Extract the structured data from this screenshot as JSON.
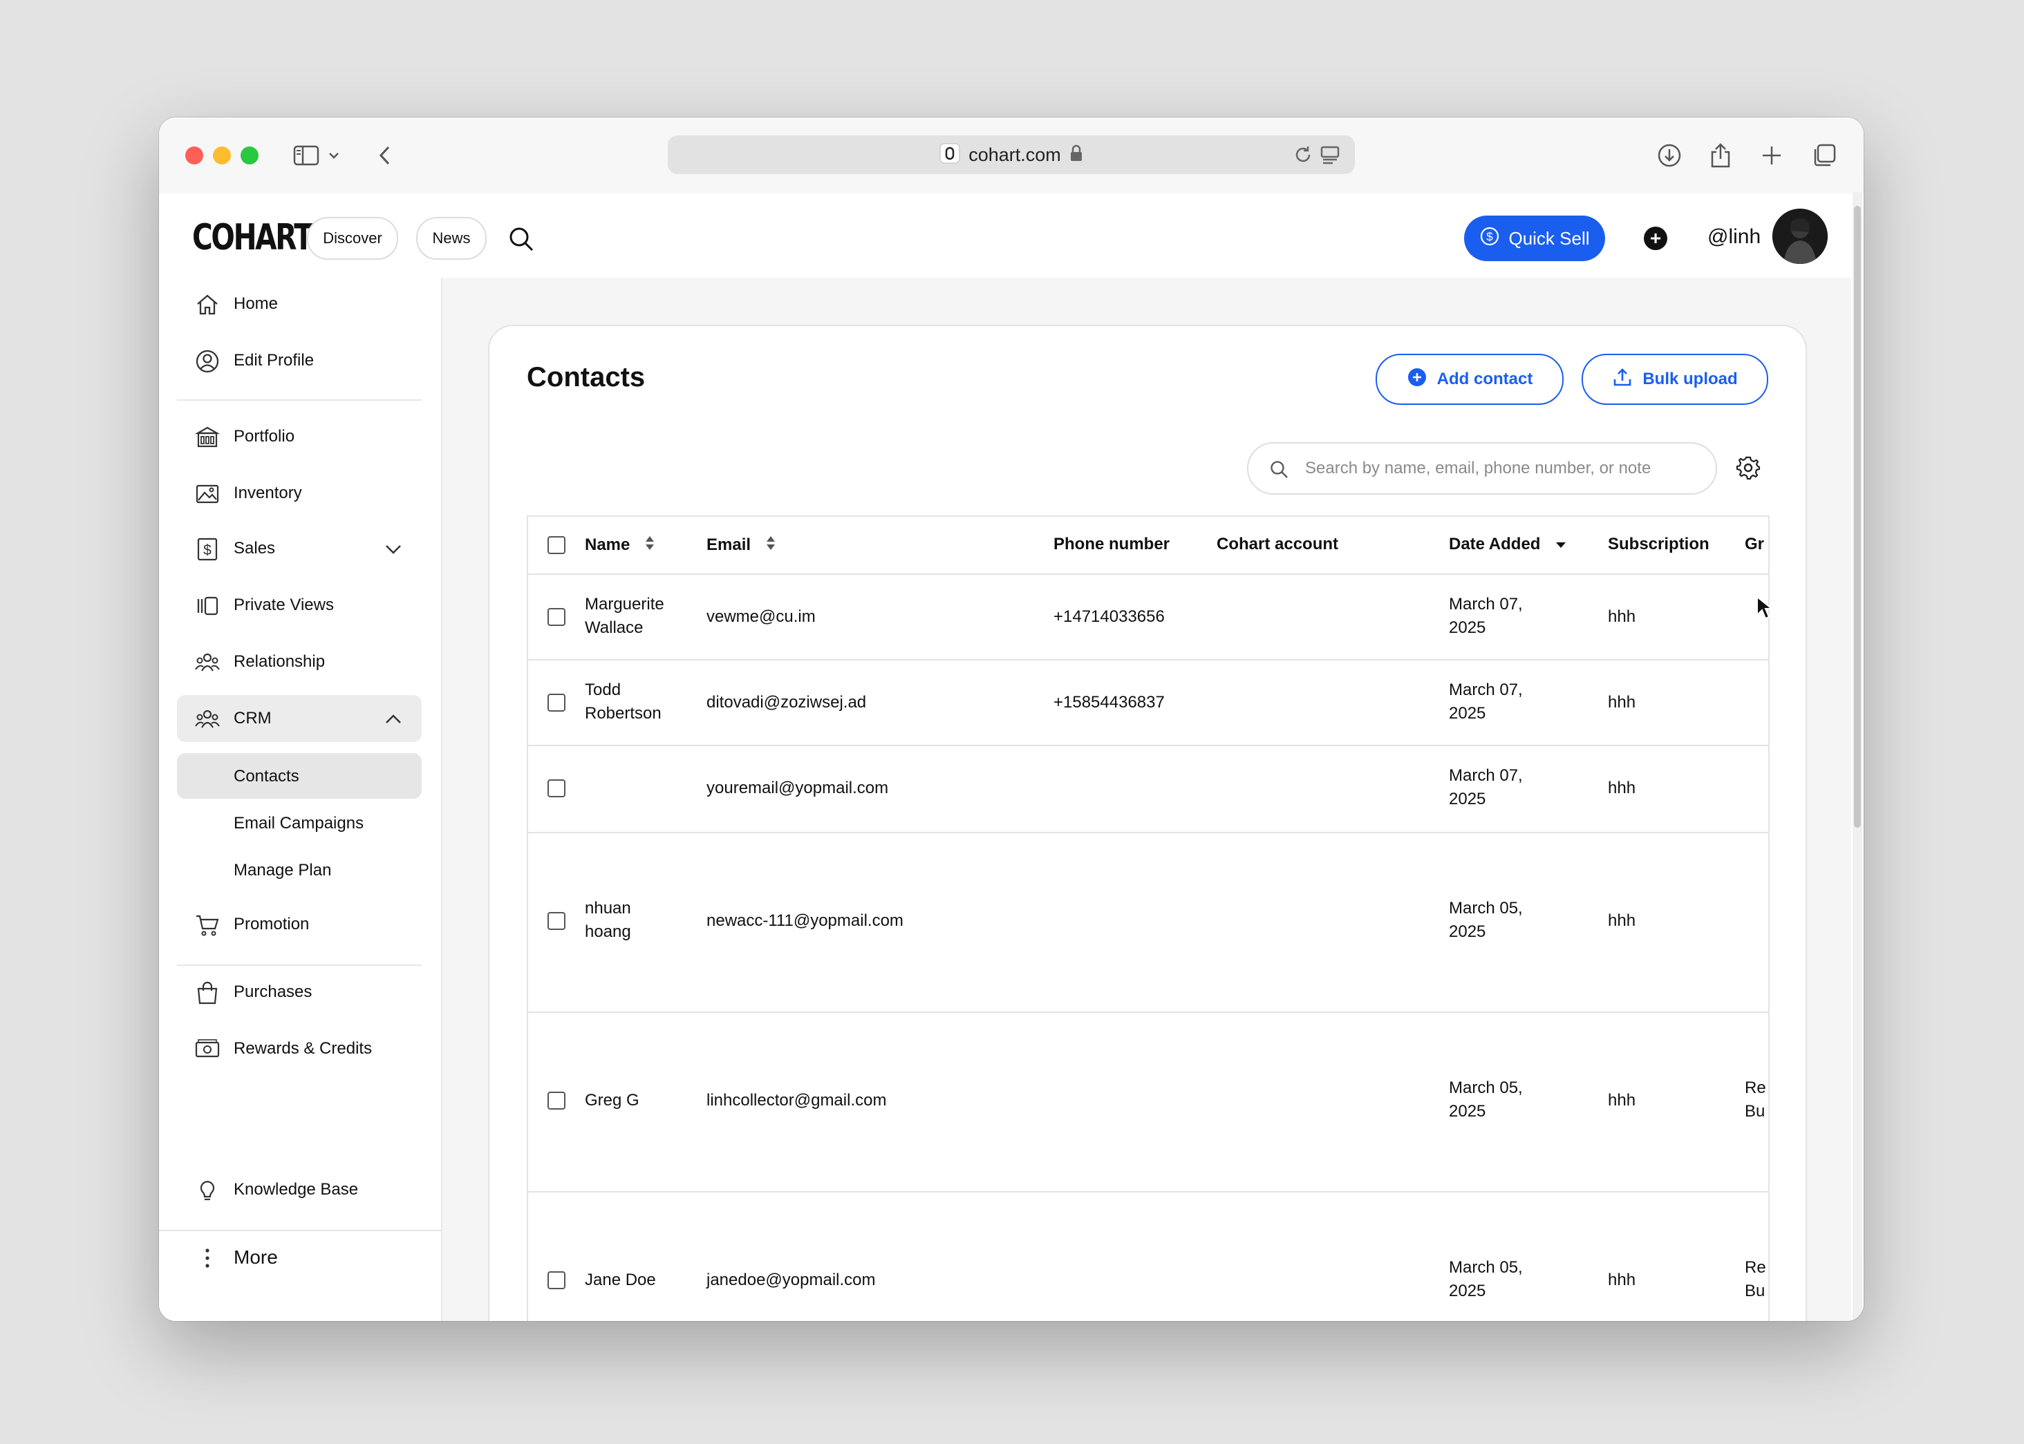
{
  "browser": {
    "url": "cohart.com"
  },
  "header": {
    "logo": "COHART",
    "nav": [
      "Discover",
      "News"
    ],
    "quick_sell_label": "Quick Sell",
    "username": "@linh"
  },
  "sidebar": {
    "items": [
      {
        "label": "Home",
        "icon": "home-icon"
      },
      {
        "label": "Edit Profile",
        "icon": "user-circle-icon"
      },
      {
        "label": "Portfolio",
        "icon": "building-icon"
      },
      {
        "label": "Inventory",
        "icon": "image-icon"
      },
      {
        "label": "Sales",
        "icon": "dollar-icon"
      },
      {
        "label": "Private Views",
        "icon": "views-icon"
      },
      {
        "label": "Relationship",
        "icon": "people-icon"
      },
      {
        "label": "CRM",
        "icon": "people-icon"
      },
      {
        "label": "Promotion",
        "icon": "cart-icon"
      },
      {
        "label": "Purchases",
        "icon": "bag-icon"
      },
      {
        "label": "Rewards & Credits",
        "icon": "money-icon"
      },
      {
        "label": "Knowledge Base",
        "icon": "bulb-icon"
      },
      {
        "label": "More",
        "icon": "more-icon"
      }
    ],
    "crm_sub": [
      "Contacts",
      "Email Campaigns",
      "Manage Plan"
    ]
  },
  "main": {
    "title": "Contacts",
    "add_contact_label": "Add contact",
    "bulk_upload_label": "Bulk upload",
    "search_placeholder": "Search by name, email, phone number, or note",
    "columns": [
      "Name",
      "Email",
      "Phone number",
      "Cohart account",
      "Date Added",
      "Subscription",
      "Gr"
    ],
    "rows": [
      {
        "name1": "Marguerite",
        "name2": "Wallace",
        "email": "vewme@cu.im",
        "phone": "+14714033656",
        "date1": "March 07,",
        "date2": "2025",
        "subscription": "hhh",
        "group1": "",
        "group2": ""
      },
      {
        "name1": "Todd",
        "name2": "Robertson",
        "email": "ditovadi@zoziwsej.ad",
        "phone": "+15854436837",
        "date1": "March 07,",
        "date2": "2025",
        "subscription": "hhh",
        "group1": "",
        "group2": ""
      },
      {
        "name1": "",
        "name2": "",
        "email": "youremail@yopmail.com",
        "phone": "",
        "date1": "March 07,",
        "date2": "2025",
        "subscription": "hhh",
        "group1": "",
        "group2": ""
      },
      {
        "name1": "nhuan",
        "name2": "hoang",
        "email": "newacc-111@yopmail.com",
        "phone": "",
        "date1": "March 05,",
        "date2": "2025",
        "subscription": "hhh",
        "group1": "",
        "group2": ""
      },
      {
        "name1": "Greg G",
        "name2": "",
        "email": "linhcollector@gmail.com",
        "phone": "",
        "date1": "March 05,",
        "date2": "2025",
        "subscription": "hhh",
        "group1": "Re",
        "group2": "Bu"
      },
      {
        "name1": "Jane Doe",
        "name2": "",
        "email": "janedoe@yopmail.com",
        "phone": "",
        "date1": "March 05,",
        "date2": "2025",
        "subscription": "hhh",
        "group1": "Re",
        "group2": "Bu"
      }
    ]
  },
  "colors": {
    "accent": "#1a5ef0",
    "active_nav": "#ececec"
  }
}
